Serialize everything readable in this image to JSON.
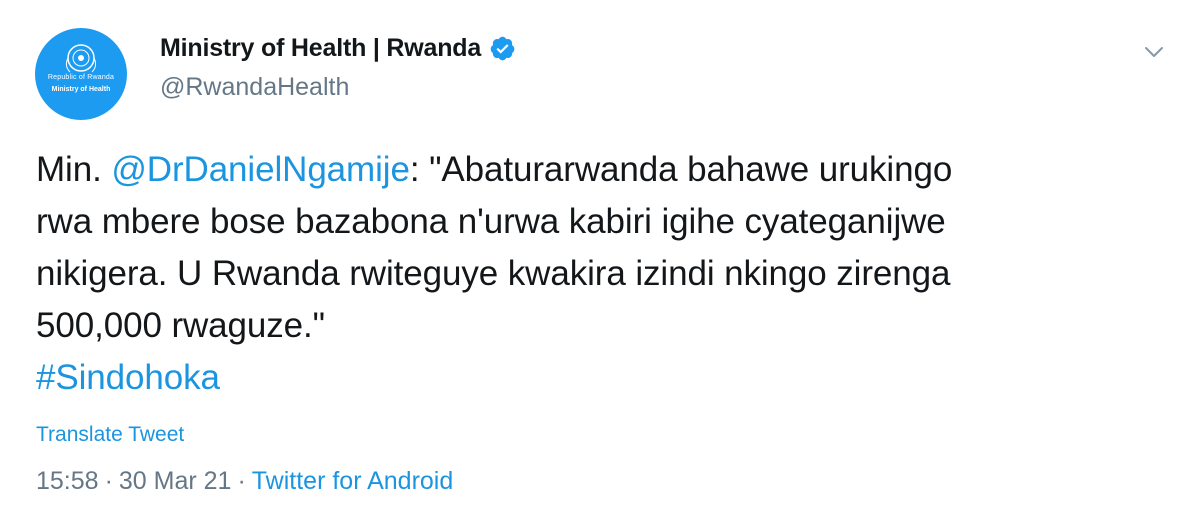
{
  "header": {
    "display_name": "Ministry of Health | Rwanda",
    "handle": "@RwandaHealth",
    "avatar": {
      "seal_line1": "Republic of Rwanda",
      "seal_line2": "Ministry of Health",
      "color": "#1d9bf0"
    },
    "verified_icon": "verified-badge-icon",
    "menu_icon": "chevron-down-icon"
  },
  "tweet": {
    "line1_prefix": "Min. ",
    "mention": "@DrDanielNgamije",
    "line1_suffix": ": \"Abaturarwanda bahawe urukingo",
    "line2": "rwa mbere bose bazabona n'urwa kabiri igihe cyateganijwe",
    "line3": "nikigera. U Rwanda rwiteguye kwakira izindi nkingo zirenga",
    "line4": "500,000 rwaguze.\"",
    "hashtag": "#Sindohoka"
  },
  "translate_label": "Translate Tweet",
  "meta": {
    "time": "15:58",
    "separator": "·",
    "date": "30 Mar 21",
    "source": "Twitter for Android"
  },
  "colors": {
    "link": "#1b95e0",
    "secondary_text": "#657786",
    "primary_text": "#14171a"
  }
}
